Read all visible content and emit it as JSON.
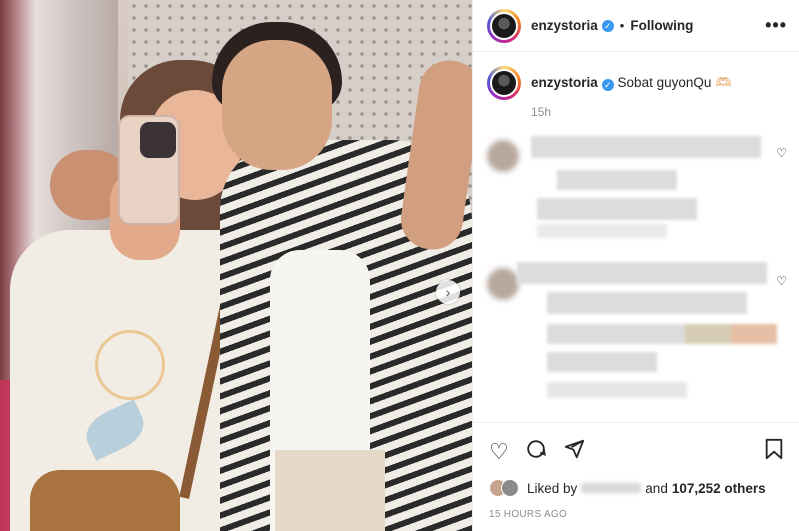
{
  "post": {
    "username": "enzystoria",
    "follow_status": "Following",
    "more_label": "•••",
    "separator": "•"
  },
  "caption": {
    "username": "enzystoria",
    "text": "Sobat guyonQu 🫶🏻",
    "time": "15h"
  },
  "comments": [
    {
      "hidden": true
    },
    {
      "hidden": true
    }
  ],
  "actions": {
    "like_icon": "heart-icon",
    "comment_icon": "comment-icon",
    "share_icon": "share-icon",
    "save_icon": "bookmark-icon"
  },
  "likes": {
    "prefix": "Liked by",
    "suffix": "and",
    "count": "107,252 others"
  },
  "timestamp": "15 HOURS AGO",
  "colors": {
    "accent_verified": "#3897f0",
    "text": "#262626",
    "muted": "#8e8e8e"
  }
}
